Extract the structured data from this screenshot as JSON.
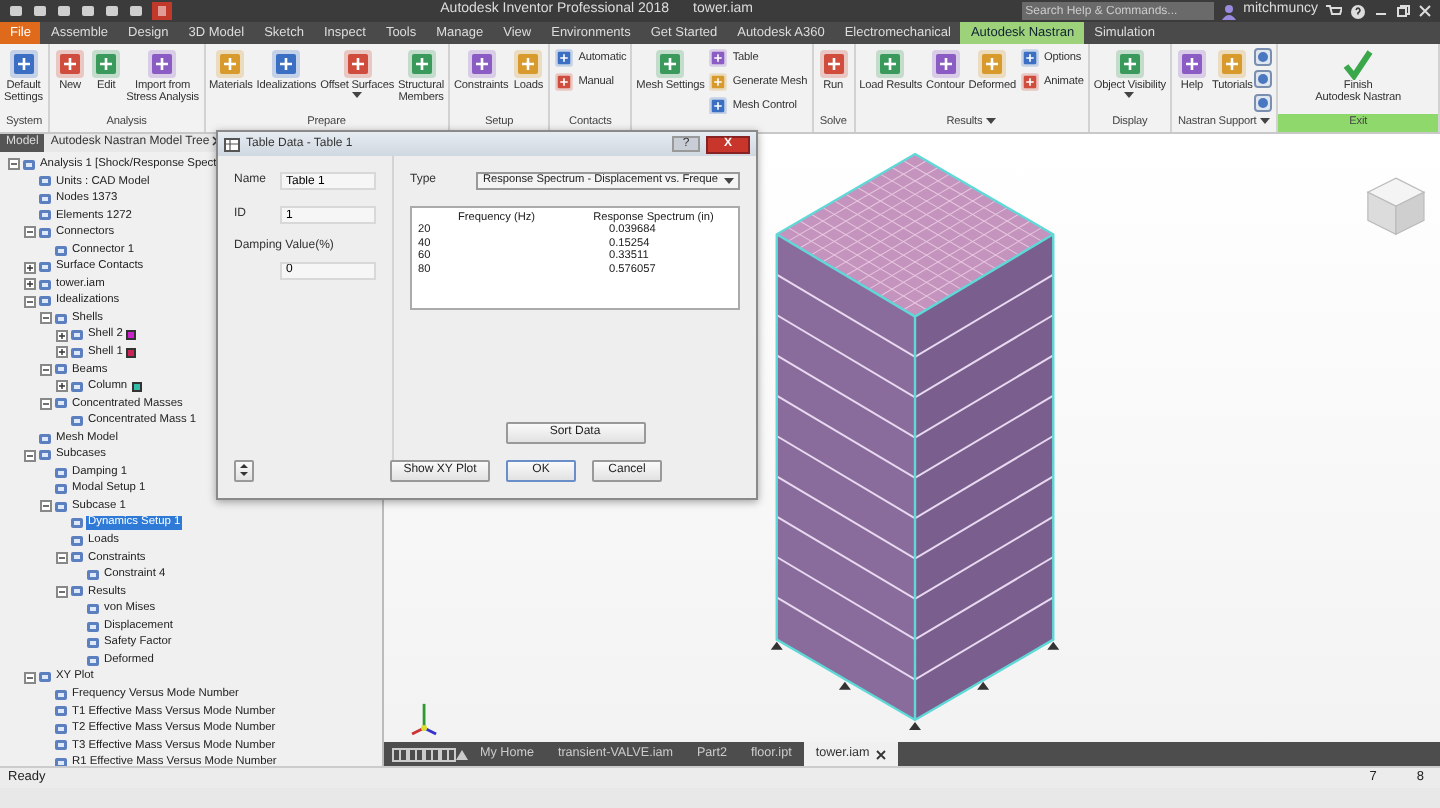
{
  "title_bar": {
    "title": "Autodesk Inventor Professional 2018",
    "document": "tower.iam",
    "search": {
      "placeholder": "Search Help & Commands..."
    },
    "user": "mitchmuncy"
  },
  "ribbon_tabs": [
    {
      "label": "File",
      "kind": "file",
      "selected": false
    },
    {
      "label": "Assemble",
      "kind": "plain",
      "selected": false
    },
    {
      "label": "Design",
      "kind": "plain",
      "selected": false
    },
    {
      "label": "3D Model",
      "kind": "plain",
      "selected": false
    },
    {
      "label": "Sketch",
      "kind": "plain",
      "selected": false
    },
    {
      "label": "Inspect",
      "kind": "plain",
      "selected": false
    },
    {
      "label": "Tools",
      "kind": "plain",
      "selected": false
    },
    {
      "label": "Manage",
      "kind": "plain",
      "selected": false
    },
    {
      "label": "View",
      "kind": "plain",
      "selected": false
    },
    {
      "label": "Environments",
      "kind": "plain",
      "selected": false
    },
    {
      "label": "Get Started",
      "kind": "plain",
      "selected": false
    },
    {
      "label": "Autodesk A360",
      "kind": "plain",
      "selected": false
    },
    {
      "label": "Electromechanical",
      "kind": "plain",
      "selected": false
    },
    {
      "label": "Autodesk Nastran",
      "kind": "plain",
      "selected": true
    },
    {
      "label": "Simulation",
      "kind": "plain",
      "selected": false
    }
  ],
  "ribbon_groups": [
    {
      "label": "System",
      "items": [
        {
          "kind": "large",
          "label": "Default\nSettings"
        }
      ]
    },
    {
      "label": "Analysis",
      "items": [
        {
          "kind": "large",
          "label": "New"
        },
        {
          "kind": "large",
          "label": "Edit"
        },
        {
          "kind": "large",
          "label": "Import from\nStress Analysis"
        }
      ]
    },
    {
      "label": "Prepare",
      "items": [
        {
          "kind": "large",
          "label": "Materials"
        },
        {
          "kind": "large",
          "label": "Idealizations"
        },
        {
          "kind": "large",
          "label": "Offset Surfaces",
          "dropdown": true
        },
        {
          "kind": "large",
          "label": "Structural\nMembers"
        }
      ]
    },
    {
      "label": "Setup",
      "items": [
        {
          "kind": "large",
          "label": "Constraints"
        },
        {
          "kind": "large",
          "label": "Loads"
        }
      ]
    },
    {
      "label": "Contacts",
      "items": [
        {
          "kind": "small",
          "label": "Automatic"
        },
        {
          "kind": "small",
          "label": "Manual"
        }
      ]
    },
    {
      "items": [
        {
          "kind": "large",
          "label": "Mesh Settings"
        },
        {
          "kind": "small",
          "label": "Table"
        },
        {
          "kind": "small",
          "label": "Generate Mesh"
        },
        {
          "kind": "small",
          "label": "Mesh Control"
        }
      ]
    },
    {
      "label": "Solve",
      "items": [
        {
          "kind": "large",
          "label": "Run"
        }
      ]
    },
    {
      "label": "Results",
      "dropdown": true,
      "items": [
        {
          "kind": "large",
          "label": "Load Results"
        },
        {
          "kind": "large",
          "label": "Contour"
        },
        {
          "kind": "large",
          "label": "Deformed"
        },
        {
          "kind": "small",
          "label": "Options"
        },
        {
          "kind": "small",
          "label": "Animate"
        }
      ]
    },
    {
      "label": "Display",
      "items": [
        {
          "kind": "large",
          "label": "Object Visibility",
          "dropdown": true
        }
      ]
    },
    {
      "label": "Nastran Support",
      "dropdown": true,
      "items": [
        {
          "kind": "large",
          "label": "Help"
        },
        {
          "kind": "large",
          "label": "Tutorials"
        },
        {
          "kind": "icon"
        },
        {
          "kind": "icon"
        },
        {
          "kind": "icon"
        }
      ]
    },
    {
      "label": "Exit",
      "accent": true,
      "items": [
        {
          "kind": "large",
          "label": "Finish\nAutodesk Nastran"
        }
      ]
    }
  ],
  "browser": {
    "tabs": [
      {
        "label": "Model",
        "selected": false
      },
      {
        "label": "Autodesk Nastran Model Tree",
        "selected": true,
        "closable": true
      }
    ],
    "tree": [
      {
        "label": "Analysis 1 [Shock/Response Spect",
        "expanded": true,
        "selected": false,
        "children": [
          {
            "label": "Units : CAD Model",
            "selected": false
          },
          {
            "label": "Nodes 1373",
            "selected": false
          },
          {
            "label": "Elements 1272",
            "selected": false
          },
          {
            "label": "Connectors",
            "expanded": true,
            "selected": false,
            "children": [
              {
                "label": "Connector 1",
                "selected": false
              }
            ]
          },
          {
            "label": "Surface Contacts",
            "expanded": false,
            "selected": false
          },
          {
            "label": "tower.iam",
            "expanded": false,
            "selected": false
          },
          {
            "label": "Idealizations",
            "expanded": true,
            "selected": false,
            "children": [
              {
                "label": "Shells",
                "expanded": true,
                "selected": false,
                "children": [
                  {
                    "label": "Shell 2",
                    "expanded": false,
                    "selected": false,
                    "color": "#cc22cc"
                  },
                  {
                    "label": "Shell 1",
                    "expanded": false,
                    "selected": false,
                    "color": "#cc2255"
                  }
                ]
              },
              {
                "label": "Beams",
                "expanded": true,
                "selected": false,
                "children": [
                  {
                    "label": "Column",
                    "expanded": false,
                    "selected": false,
                    "color": "#33bba8"
                  }
                ]
              },
              {
                "label": "Concentrated Masses",
                "expanded": true,
                "selected": false,
                "children": [
                  {
                    "label": "Concentrated Mass 1",
                    "selected": false
                  }
                ]
              }
            ]
          },
          {
            "label": "Mesh Model",
            "selected": false
          },
          {
            "label": "Subcases",
            "expanded": true,
            "selected": false,
            "children": [
              {
                "label": "Damping 1",
                "selected": false
              },
              {
                "label": "Modal Setup 1",
                "selected": false
              },
              {
                "label": "Subcase 1",
                "expanded": true,
                "selected": false,
                "children": [
                  {
                    "label": "Dynamics Setup 1",
                    "selected": true
                  },
                  {
                    "label": "Loads",
                    "selected": false
                  },
                  {
                    "label": "Constraints",
                    "expanded": true,
                    "selected": false,
                    "children": [
                      {
                        "label": "Constraint 4",
                        "selected": false
                      }
                    ]
                  },
                  {
                    "label": "Results",
                    "expanded": true,
                    "selected": false,
                    "children": [
                      {
                        "label": "von Mises",
                        "selected": false
                      },
                      {
                        "label": "Displacement",
                        "selected": false
                      },
                      {
                        "label": "Safety Factor",
                        "selected": false
                      },
                      {
                        "label": "Deformed",
                        "selected": false
                      }
                    ]
                  }
                ]
              }
            ]
          },
          {
            "label": "XY Plot",
            "expanded": true,
            "selected": false,
            "children": [
              {
                "label": "Frequency Versus Mode Number",
                "selected": false
              },
              {
                "label": "T1 Effective Mass Versus Mode Number",
                "selected": false
              },
              {
                "label": "T2 Effective Mass Versus Mode Number",
                "selected": false
              },
              {
                "label": "T3 Effective Mass Versus Mode Number",
                "selected": false
              },
              {
                "label": "R1 Effective Mass Versus Mode Number",
                "selected": false
              }
            ]
          }
        ]
      }
    ]
  },
  "dialog": {
    "title": "Table Data - Table 1",
    "help": "?",
    "close": "X",
    "fields": [
      {
        "label": "Name",
        "value": "Table 1"
      },
      {
        "label": "ID",
        "value": "1"
      },
      {
        "label": "Damping Value(%)",
        "value": "0"
      }
    ],
    "type": {
      "label": "Type",
      "value": "Response Spectrum - Displacement vs. Freque"
    },
    "table": {
      "columns": [
        "Frequency (Hz)",
        "Response Spectrum (in)"
      ],
      "rows": [
        [
          "20",
          "0.039684"
        ],
        [
          "40",
          "0.15254"
        ],
        [
          "60",
          "0.33511"
        ],
        [
          "80",
          "0.576057"
        ]
      ]
    },
    "sort_button": "Sort Data",
    "buttons": [
      "Show XY Plot",
      "OK",
      "Cancel"
    ]
  },
  "document_tabs": [
    {
      "label": "My Home",
      "selected": false
    },
    {
      "label": "transient-VALVE.iam",
      "selected": false
    },
    {
      "label": "Part2",
      "selected": false
    },
    {
      "label": "floor.ipt",
      "selected": false
    },
    {
      "label": "tower.iam",
      "selected": true,
      "closable": true
    }
  ],
  "status_bar": {
    "text": "Ready",
    "counts": [
      "7",
      "8"
    ]
  }
}
